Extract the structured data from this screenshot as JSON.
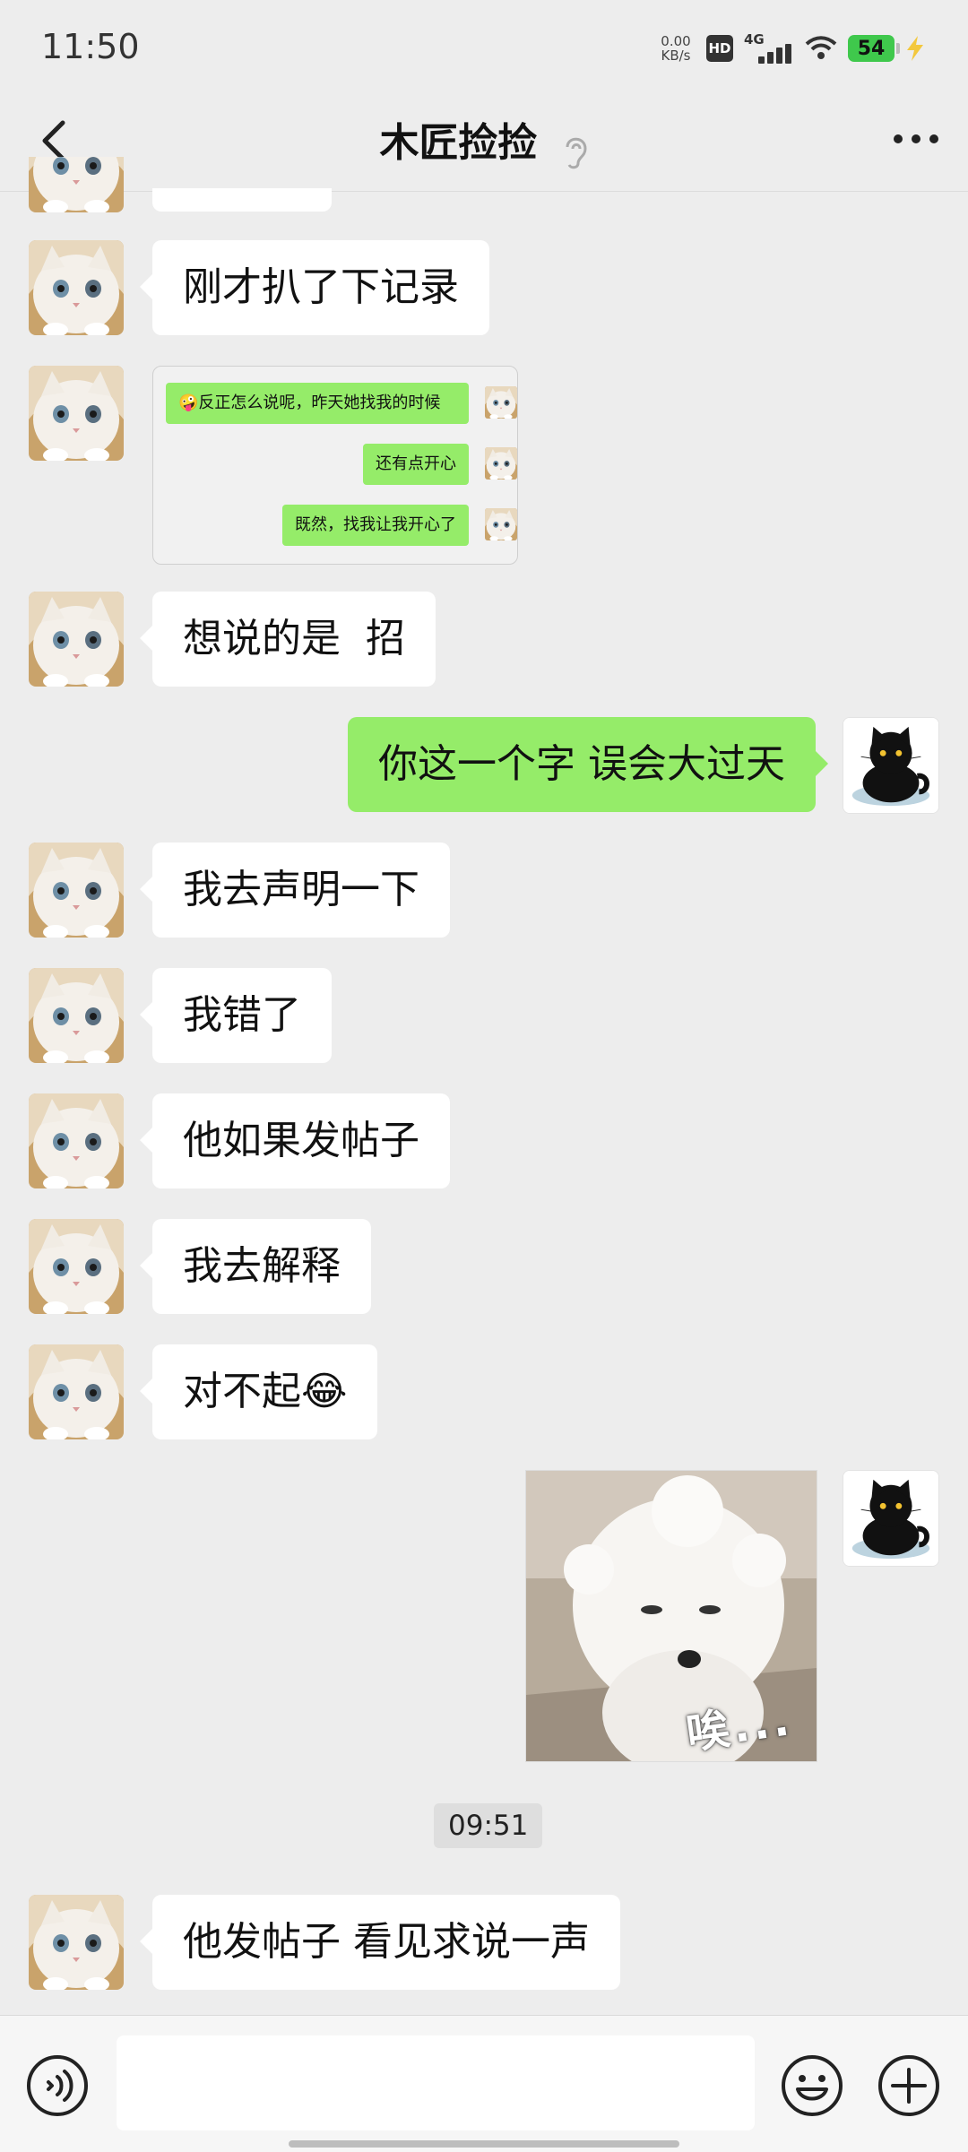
{
  "status_bar": {
    "time": "11:50",
    "net_speed": "0.00",
    "net_unit": "KB/s",
    "hd": "HD",
    "network": "4G",
    "battery": "54"
  },
  "nav": {
    "title": "木匠捡捡",
    "back_icon": "chevron-left-icon",
    "listen_icon": "ear-icon",
    "more_icon": "more-horizontal-icon"
  },
  "messages": [
    {
      "from": "them",
      "text": "刚才扒了下记录"
    },
    {
      "from": "them",
      "type": "screenshot",
      "lines": [
        "🤪反正怎么说呢，昨天她找我的时候",
        "还有点开心",
        "既然，找我让我开心了"
      ]
    },
    {
      "from": "them",
      "text": "想说的是  招"
    },
    {
      "from": "me",
      "text": "你这一个字 误会大过天"
    },
    {
      "from": "them",
      "text": "我去声明一下"
    },
    {
      "from": "them",
      "text": "我错了"
    },
    {
      "from": "them",
      "text": "他如果发帖子"
    },
    {
      "from": "them",
      "text": "我去解释"
    },
    {
      "from": "them",
      "text": "对不起😂"
    },
    {
      "from": "me",
      "type": "sticker",
      "caption": "唉..."
    },
    {
      "from": "them",
      "text": "他发帖子 看见求说一声"
    }
  ],
  "timestamp": "09:51",
  "input": {
    "placeholder": "",
    "voice_icon": "voice-icon",
    "emoji_icon": "emoji-icon",
    "plus_icon": "plus-icon"
  },
  "colors": {
    "background": "#ededed",
    "bubble_out": "#95ec69",
    "bubble_in": "#ffffff"
  }
}
